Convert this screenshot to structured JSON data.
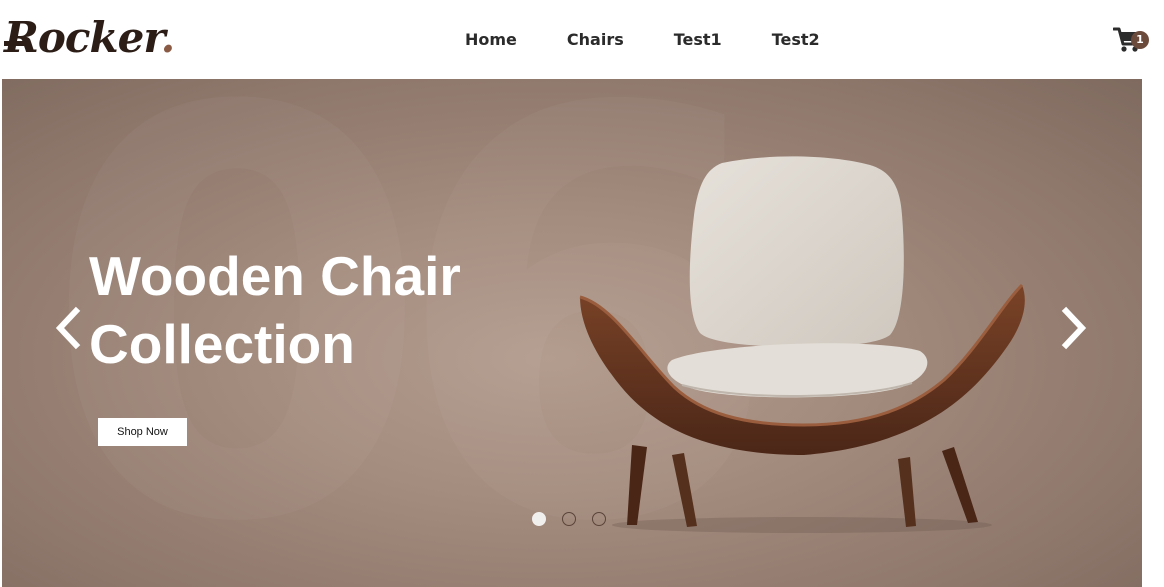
{
  "header": {
    "logo": {
      "text": "Rocker",
      "dot": "."
    },
    "nav": [
      {
        "label": "Home"
      },
      {
        "label": "Chairs"
      },
      {
        "label": "Test1"
      },
      {
        "label": "Test2"
      }
    ],
    "cart": {
      "icon": "cart-icon",
      "count": "1"
    }
  },
  "hero": {
    "bg_number": "06",
    "title_line1": "Wooden Chair",
    "title_line2": "Collection",
    "button": "Shop Now",
    "prev_icon": "chevron-left-icon",
    "next_icon": "chevron-right-icon",
    "image": "chair-image",
    "slides": 3,
    "active_slide": 1
  },
  "colors": {
    "brand": "#2c1d17",
    "accent": "#8a5a44",
    "hero_bg": "#a48c7e",
    "badge": "#6b4a3b"
  }
}
